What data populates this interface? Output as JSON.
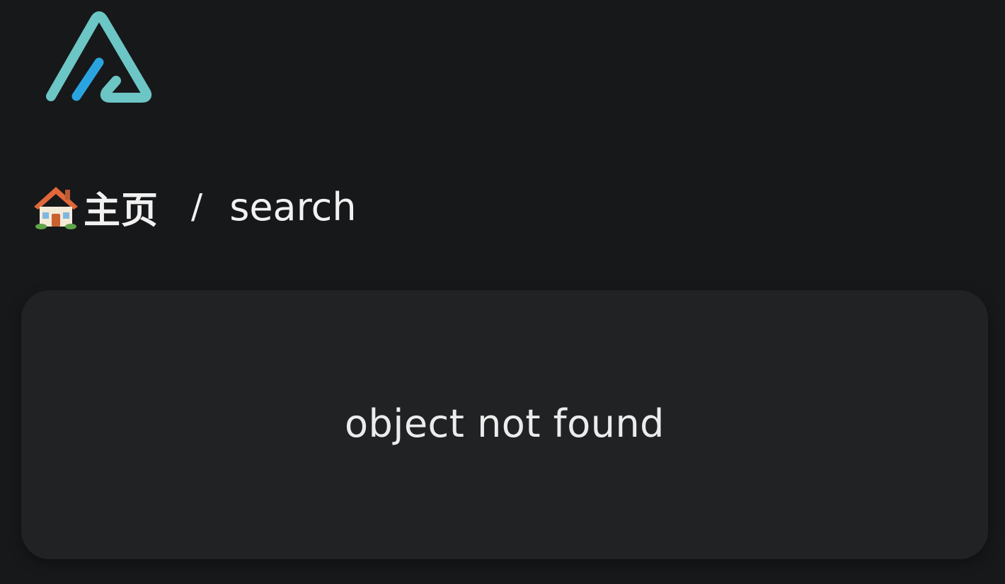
{
  "logo": {
    "icon": "triangle-logo-icon",
    "colors": {
      "outline": "#6cc6c5",
      "stroke": "#2aa4e0"
    }
  },
  "breadcrumb": {
    "home_icon": "house-icon",
    "home_label": "主页",
    "separator": "/",
    "current": "search"
  },
  "main": {
    "message": "object not found"
  },
  "colors": {
    "background": "#17181a",
    "panel": "#202224",
    "text": "#f1f1f1"
  }
}
